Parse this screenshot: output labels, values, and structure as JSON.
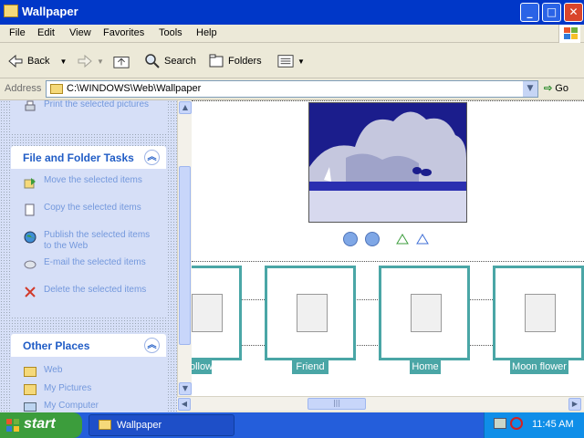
{
  "window": {
    "title": "Wallpaper",
    "controls": {
      "minimize": "_",
      "maximize": "□",
      "close": "✕"
    }
  },
  "menu": {
    "items": [
      "File",
      "Edit",
      "View",
      "Favorites",
      "Tools",
      "Help"
    ]
  },
  "toolbar": {
    "back_label": "Back",
    "search_label": "Search",
    "folders_label": "Folders",
    "back_icon": "back-arrow-icon",
    "forward_icon": "forward-arrow-icon",
    "up_icon": "folder-up-icon",
    "search_icon": "magnifier-icon",
    "folders_icon": "folders-icon",
    "views_icon": "views-icon"
  },
  "address": {
    "label": "Address",
    "path": "C:\\WINDOWS\\Web\\Wallpaper",
    "go_label": "Go"
  },
  "left_pane": {
    "top_task": "Print the selected pictures",
    "file_folder": {
      "title": "File and Folder Tasks",
      "collapse_glyph": "︽",
      "tasks": [
        "Move the selected items",
        "Copy the selected items",
        "Publish the selected items to the Web",
        "E-mail the selected items",
        "Delete the selected items"
      ]
    },
    "other_places": {
      "title": "Other Places",
      "collapse_glyph": "︽",
      "items": [
        "Web",
        "My Pictures",
        "My Computer"
      ]
    }
  },
  "content": {
    "thumbnails": [
      {
        "label": "Follow"
      },
      {
        "label": "Friend"
      },
      {
        "label": "Home"
      },
      {
        "label": "Moon flower"
      }
    ],
    "first_label_visible": "ollow"
  },
  "taskbar": {
    "start_label": "start",
    "task_button_label": "Wallpaper",
    "clock": "11:45 AM"
  },
  "colors": {
    "title_bar": "#0037c8",
    "task_link": "#215dc6",
    "thumb_border": "#4aa6a6",
    "taskbar": "#245edb",
    "start_green": "#3c9d3c"
  }
}
